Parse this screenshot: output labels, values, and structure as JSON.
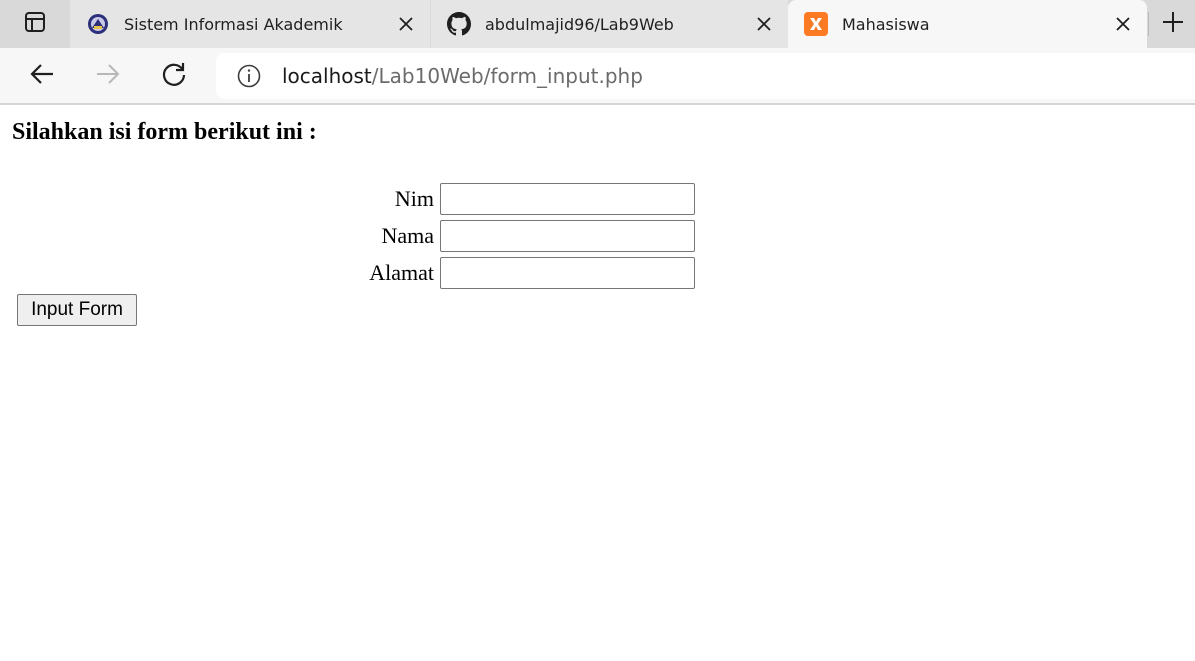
{
  "browser": {
    "tabs": [
      {
        "title": "Sistem Informasi Akademik",
        "icon": "university-logo-icon",
        "active": false
      },
      {
        "title": "abdulmajid96/Lab9Web",
        "icon": "github-icon",
        "active": false
      },
      {
        "title": "Mahasiswa",
        "icon": "xampp-icon",
        "active": true
      }
    ],
    "address": {
      "host": "localhost",
      "path": "/Lab10Web/form_input.php"
    }
  },
  "page": {
    "heading": "Silahkan isi form berikut ini :",
    "form": {
      "fields": [
        {
          "label": "Nim",
          "value": ""
        },
        {
          "label": "Nama",
          "value": ""
        },
        {
          "label": "Alamat",
          "value": ""
        }
      ],
      "submit_label": "Input Form"
    }
  },
  "colors": {
    "tabstrip_bg": "#d9d9d9",
    "active_tab_bg": "#f7f7f7",
    "xampp_orange": "#fb7a24"
  }
}
